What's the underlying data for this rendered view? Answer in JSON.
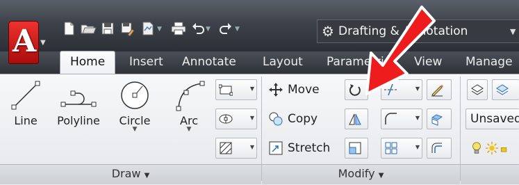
{
  "app": {
    "logo_letter": "A",
    "brand_color": "#d51f1b"
  },
  "quick_access": {
    "icons": [
      "new-icon",
      "open-icon",
      "save-icon",
      "save-as-icon",
      "plot-icon",
      "print-icon",
      "undo-icon",
      "redo-icon"
    ],
    "workspace": {
      "label": "Drafting & Annotation"
    }
  },
  "tabs": [
    {
      "label": "Home",
      "active": true
    },
    {
      "label": "Insert"
    },
    {
      "label": "Annotate"
    },
    {
      "label": "Layout"
    },
    {
      "label": "Parametric"
    },
    {
      "label": "View"
    },
    {
      "label": "Manage"
    }
  ],
  "panels": {
    "draw": {
      "title": "Draw",
      "tools": [
        {
          "label": "Line"
        },
        {
          "label": "Polyline"
        },
        {
          "label": "Circle"
        },
        {
          "label": "Arc"
        }
      ]
    },
    "modify": {
      "title": "Modify",
      "tools": [
        {
          "label": "Move"
        },
        {
          "label": "Copy"
        },
        {
          "label": "Stretch"
        }
      ]
    },
    "layers": {
      "unsaved_label": "Unsaved"
    }
  },
  "overlay": {
    "arrow_color": "#ee1c1c"
  }
}
